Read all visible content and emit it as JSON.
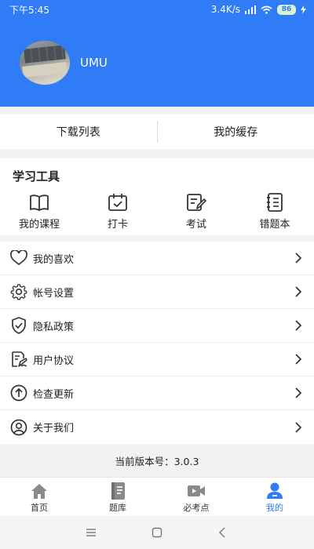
{
  "status": {
    "time": "下午5:45",
    "network_speed": "3.4K/s",
    "battery": "86"
  },
  "profile": {
    "username": "UMU"
  },
  "quick_actions": {
    "download_list": "下载列表",
    "my_cache": "我的缓存"
  },
  "tools": {
    "title": "学习工具",
    "items": [
      {
        "label": "我的课程",
        "icon": "book-icon"
      },
      {
        "label": "打卡",
        "icon": "calendar-check-icon"
      },
      {
        "label": "考试",
        "icon": "exam-edit-icon"
      },
      {
        "label": "错题本",
        "icon": "notebook-list-icon"
      }
    ]
  },
  "menu": [
    {
      "label": "我的喜欢",
      "icon": "heart-icon"
    },
    {
      "label": "帐号设置",
      "icon": "gear-icon"
    },
    {
      "label": "隐私政策",
      "icon": "shield-check-icon"
    },
    {
      "label": "用户协议",
      "icon": "agreement-icon"
    },
    {
      "label": "检查更新",
      "icon": "upload-circle-icon"
    },
    {
      "label": "关于我们",
      "icon": "user-circle-icon"
    }
  ],
  "version_text": "当前版本号：3.0.3",
  "bottom_nav": [
    {
      "label": "首页",
      "icon": "home-icon"
    },
    {
      "label": "题库",
      "icon": "question-bank-icon"
    },
    {
      "label": "必考点",
      "icon": "video-icon"
    },
    {
      "label": "我的",
      "icon": "profile-icon"
    }
  ],
  "colors": {
    "brand": "#2f7cf6",
    "background": "#f2f2f2"
  }
}
